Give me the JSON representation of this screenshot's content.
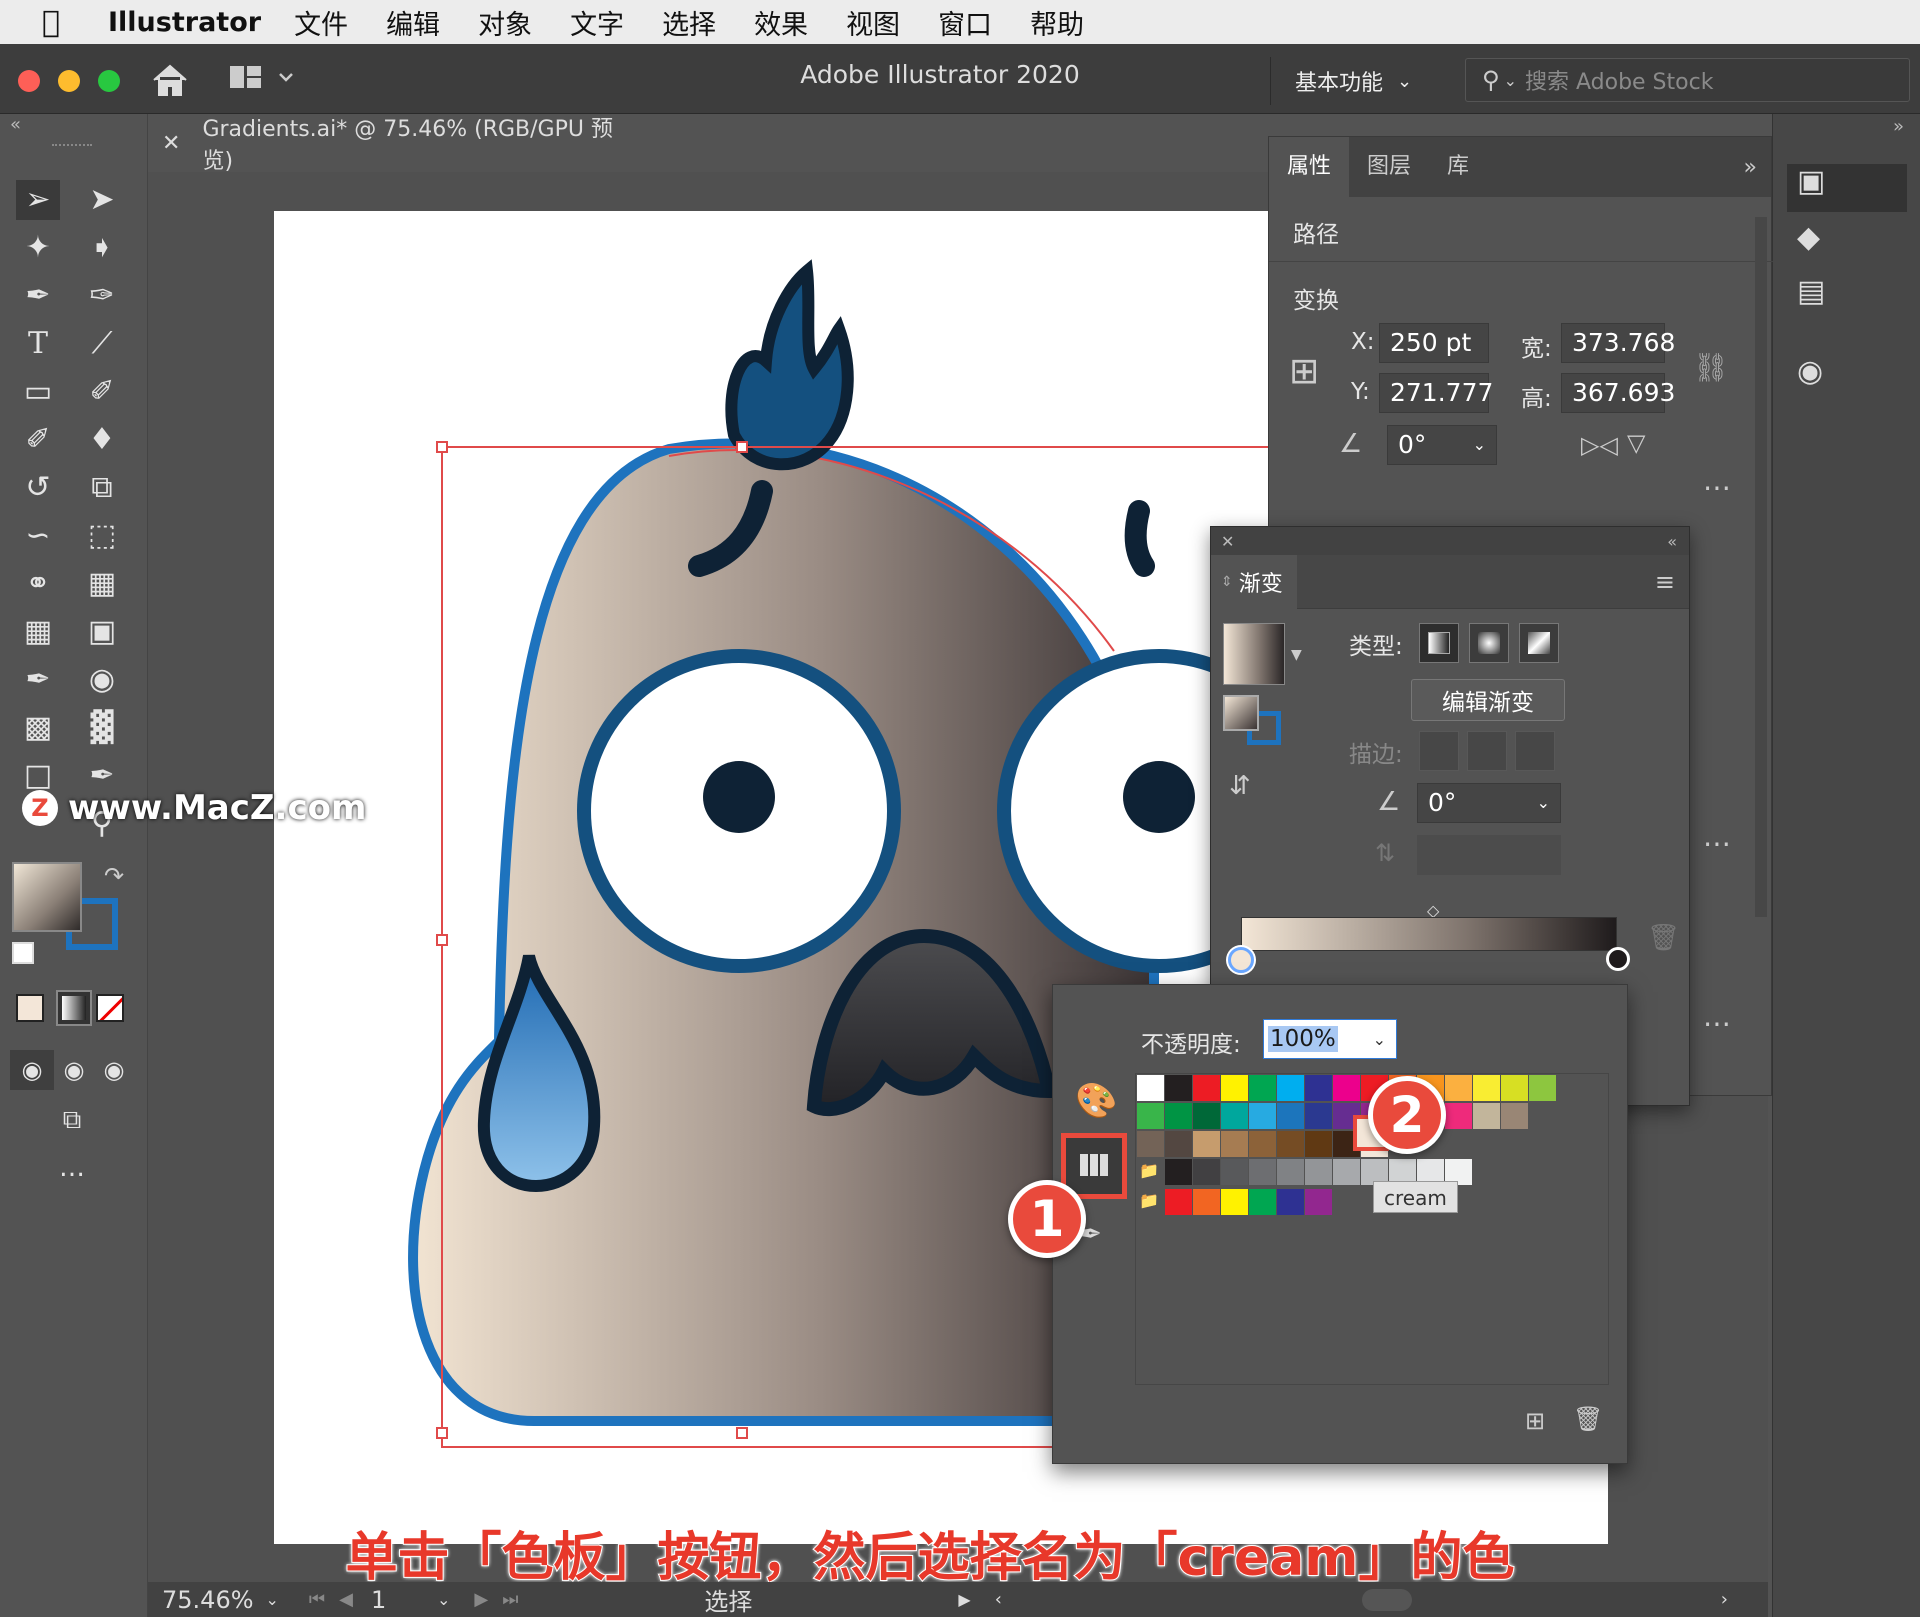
{
  "menubar": {
    "app_name": "Illustrator",
    "items": [
      "文件",
      "编辑",
      "对象",
      "文字",
      "选择",
      "效果",
      "视图",
      "窗口",
      "帮助"
    ]
  },
  "titlebar": {
    "title": "Adobe Illustrator 2020",
    "workspace": "基本功能",
    "search_placeholder": "搜索 Adobe Stock"
  },
  "document": {
    "tab_title": "Gradients.ai* @ 75.46% (RGB/GPU 预览)",
    "watermark": "www.MacZ.com"
  },
  "properties": {
    "tabs": [
      "属性",
      "图层",
      "库"
    ],
    "section_path": "路径",
    "section_transform": "变换",
    "x_label": "X:",
    "x_value": "250 pt",
    "y_label": "Y:",
    "y_value": "271.777",
    "w_label": "宽:",
    "w_value": "373.768",
    "h_label": "高:",
    "h_value": "367.693",
    "angle_value": "0°"
  },
  "gradient_panel": {
    "title": "渐变",
    "type_label": "类型:",
    "edit_button": "编辑渐变",
    "stroke_label": "描边:",
    "angle_value": "0°"
  },
  "swatches_popup": {
    "opacity_label": "不透明度:",
    "opacity_value": "100%",
    "tooltip": "cream",
    "row1": [
      "#ffffff",
      "#231f20",
      "#ed1c24",
      "#fff200",
      "#00a651",
      "#00aeef",
      "#2e3192",
      "#ec008c",
      "#ed1c24",
      "#f26522",
      "#f7941d",
      "#fbb040",
      "#f9ed32",
      "#d7df23",
      "#8dc63f"
    ],
    "row2": [
      "#39b54a",
      "#009444",
      "#006838",
      "#00a79d",
      "#27aae1",
      "#1c75bc",
      "#2b3990",
      "#662d91",
      "#92278f",
      "#9e1f63",
      "#da1c5c",
      "#ee2a7b",
      "#c2b59b",
      "#998675"
    ],
    "row3": [
      "#736357",
      "#534741",
      "#c69c6d",
      "#a67c52",
      "#8c6239",
      "#754c24",
      "#603913",
      "#3c2415",
      "#f2e6d9"
    ],
    "grays": [
      "#231f20",
      "#414042",
      "#58595b",
      "#6d6e71",
      "#808285",
      "#939598",
      "#a7a9ac",
      "#bcbec0",
      "#d1d3d4",
      "#e6e7e8",
      "#f1f2f2"
    ],
    "brights": [
      "#ed1c24",
      "#f26522",
      "#fff200",
      "#00a651",
      "#2e3192",
      "#92278f"
    ]
  },
  "annotations": {
    "badge1": "1",
    "badge2": "2",
    "caption": "单击「色板」按钮，然后选择名为「cream」的色板"
  },
  "statusbar": {
    "zoom": "75.46%",
    "page": "1",
    "tool": "选择"
  },
  "colors": {
    "accent_red": "#e94a3c",
    "selection_red": "#e04a4a",
    "outline_blue": "#1e73be",
    "ink": "#0e2235"
  }
}
